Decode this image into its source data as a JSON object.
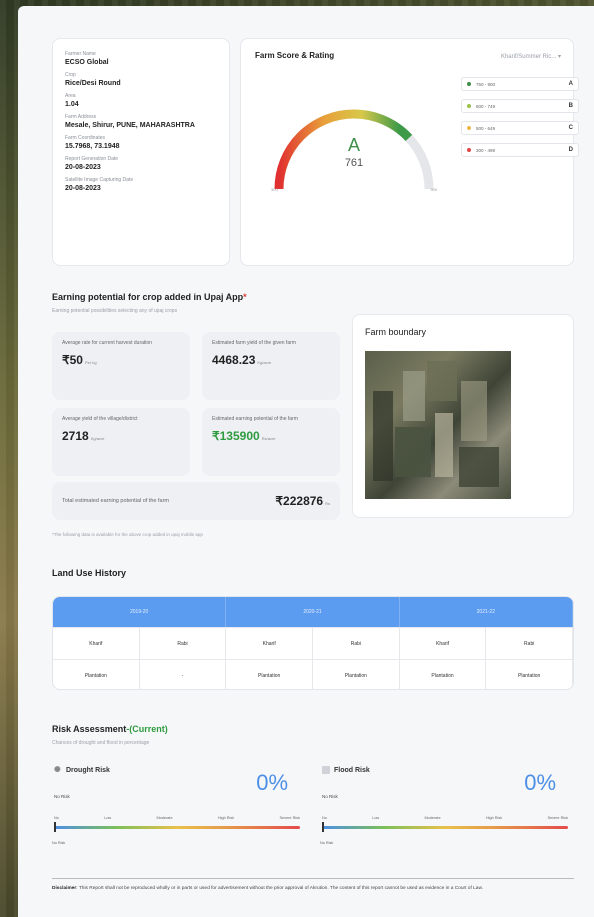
{
  "farm_info": [
    {
      "label": "Farmer Name",
      "value": "ECSO Global"
    },
    {
      "label": "Crop",
      "value": "Rice/Desi Round"
    },
    {
      "label": "Area",
      "value": "1.04"
    },
    {
      "label": "Farm Address",
      "value": "Mesale, Shirur, PUNE, MAHARASHTRA"
    },
    {
      "label": "Farm Coordinates",
      "value": "15.7968, 73.1948"
    },
    {
      "label": "Report Generation Date",
      "value": "20-08-2023"
    },
    {
      "label": "Satellite Image Capturing Date",
      "value": "20-08-2023"
    }
  ],
  "score": {
    "title": "Farm Score & Rating",
    "dropdown": "Kharif/Summer Ric...",
    "grade": "A",
    "value": "761",
    "value_fraction": 0.761,
    "gauge_min": "300",
    "gauge_max": "900",
    "legend": [
      {
        "range": "750 - 900",
        "grade": "A",
        "color": "#3f8f4a"
      },
      {
        "range": "600 - 749",
        "grade": "B",
        "color": "#9bc24a"
      },
      {
        "range": "500 - 649",
        "grade": "C",
        "color": "#e8b64a"
      },
      {
        "range": "300 - 499",
        "grade": "D",
        "color": "#e04848"
      }
    ]
  },
  "earning": {
    "title": "Earning potential for crop added in Upaj App",
    "asterisk": "*",
    "subtitle": "Earning potential possibilities selecting any of upaj crops",
    "cards": [
      {
        "label": "Average rate for current harvest duration",
        "value": "₹50",
        "unit": "Per kg"
      },
      {
        "label": "Estimated farm yield of the given farm",
        "value": "4468.23",
        "unit": "Kg/acre"
      },
      {
        "label": "Average yield of the village/district",
        "value": "2718",
        "unit": "Kg/acre"
      },
      {
        "label": "Estimated earning potential of the farm",
        "value": "₹135900",
        "unit": "Rs/acre"
      }
    ],
    "total_label": "Total estimated earning potential of the farm",
    "total_value": "₹222876",
    "total_unit": "Rs",
    "footnote": "*The following data is available for the above crop added in upaj mobile app"
  },
  "farm_boundary": {
    "title": "Farm boundary"
  },
  "land_use": {
    "title": "Land Use History",
    "years": [
      "2019-20",
      "2020-21",
      "2021-22"
    ],
    "seasons": [
      "Kharif",
      "Rabi",
      "Kharif",
      "Rabi",
      "Kharif",
      "Rabi"
    ],
    "crops": [
      "Plantation",
      "-",
      "Plantation",
      "Plantation",
      "Plantation",
      "Plantation"
    ]
  },
  "risk": {
    "title": "Risk Assessment",
    "title_suffix": "-(Current)",
    "subtitle": "Chances of drought and flood in percentage",
    "ticks": [
      "No",
      "Low",
      "Moderate",
      "High Risk",
      "Severe Risk"
    ],
    "drought": {
      "name": "Drought Risk",
      "percent": "0%",
      "level": "No Risk",
      "marker": "No Risk"
    },
    "flood": {
      "name": "Flood Risk",
      "percent": "0%",
      "level": "No Risk",
      "marker": "No Risk"
    }
  },
  "disclaimer": {
    "label": "Disclaimer",
    "text": ": This Report shall not be reproduced wholly or in parts or used for advertisement without the prior approval of Akrution. The content of this report cannot be used as evidence in a Court of Law."
  }
}
